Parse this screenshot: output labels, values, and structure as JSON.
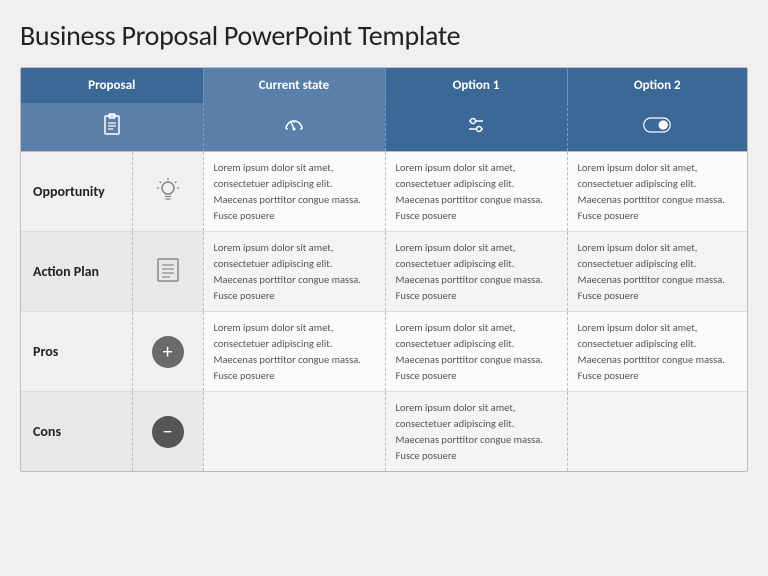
{
  "title": "Business Proposal PowerPoint Template",
  "table": {
    "headers": {
      "proposal": "Proposal",
      "current_state": "Current state",
      "option1": "Option 1",
      "option2": "Option 2"
    },
    "lorem": "Lorem ipsum dolor sit amet, consectetuer adipiscing elit. Maecenas porttitor congue massa. Fusce posuere",
    "rows": [
      {
        "id": "opportunity",
        "label": "Opportunity"
      },
      {
        "id": "actionplan",
        "label": "Action Plan"
      },
      {
        "id": "pros",
        "label": "Pros"
      },
      {
        "id": "cons",
        "label": "Cons"
      }
    ]
  }
}
